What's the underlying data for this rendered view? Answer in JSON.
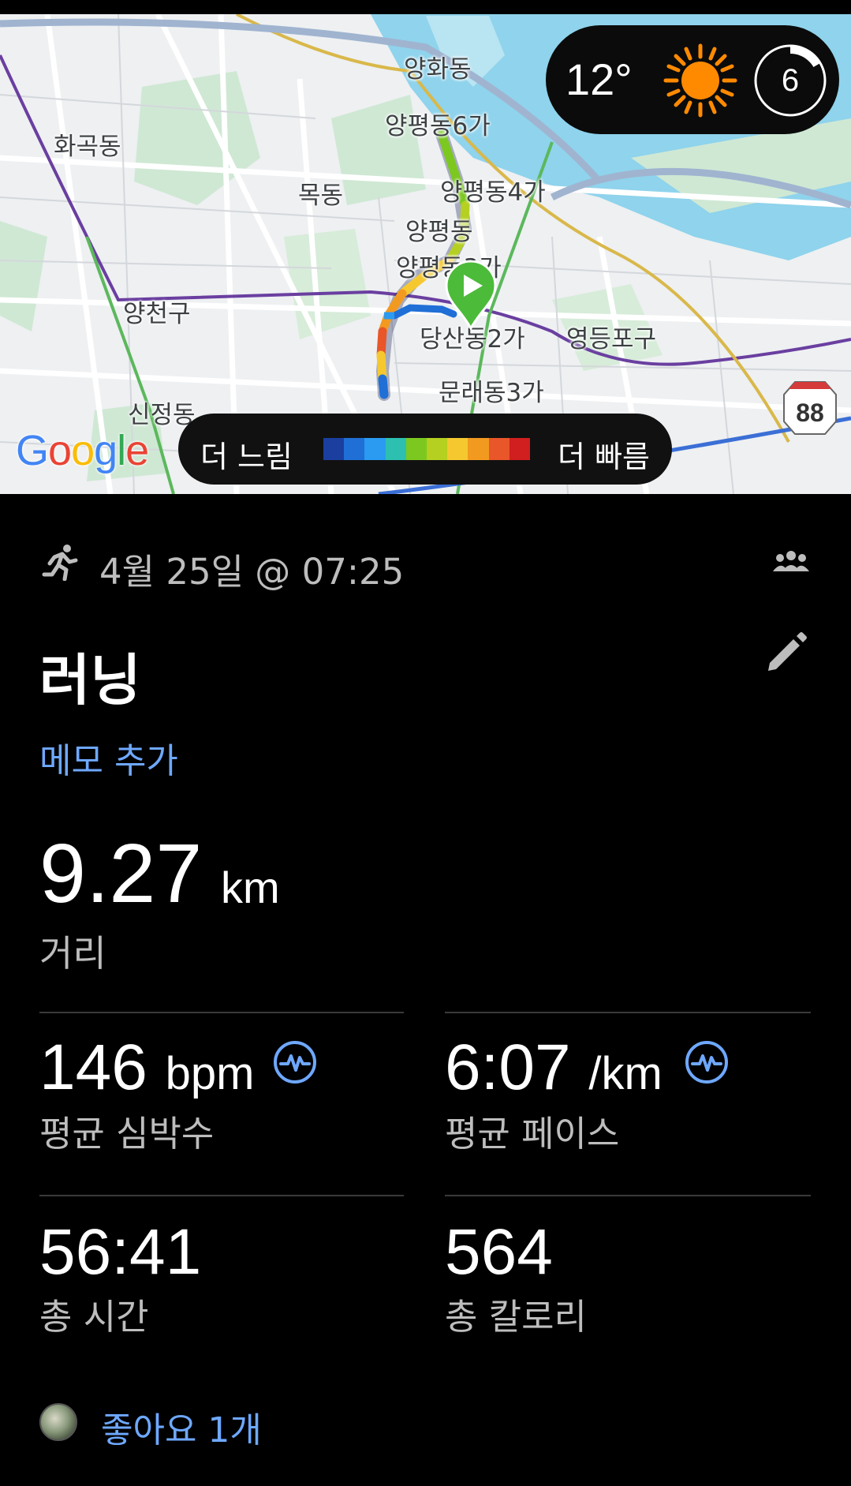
{
  "map": {
    "labels": [
      "양화동",
      "양평동6가",
      "화곡동",
      "목동",
      "양평동4가",
      "양평동",
      "양평동3가",
      "양천구",
      "당산동2가",
      "영등포구",
      "문래동3가",
      "신정동"
    ],
    "weather": {
      "temperature": "12°",
      "uv_index": "6",
      "icon": "sun-icon"
    },
    "google_logo": "Google",
    "route_marker": "88",
    "legend": {
      "slow_label": "더 느림",
      "fast_label": "더 빠름",
      "colors": [
        "#1a3f9e",
        "#1f6fd6",
        "#2a9bf0",
        "#2dc0b0",
        "#7cc820",
        "#b5d020",
        "#f5c830",
        "#f29a20",
        "#e8562a",
        "#d11e1e"
      ]
    }
  },
  "workout": {
    "activity_icon": "running-icon",
    "date": "4월 25일 @ 07:25",
    "title": "러닝",
    "add_memo": "메모 추가",
    "distance": {
      "value": "9.27",
      "unit": "km",
      "label": "거리"
    },
    "metrics": [
      {
        "value": "146",
        "unit": "bpm",
        "label": "평균 심박수",
        "icon": "pulse-icon"
      },
      {
        "value": "6:07",
        "unit": "/km",
        "label": "평균 페이스",
        "icon": "pulse-icon"
      },
      {
        "value": "56:41",
        "unit": "",
        "label": "총 시간"
      },
      {
        "value": "564",
        "unit": "",
        "label": "총 칼로리"
      }
    ],
    "likes": "좋아요 1개"
  },
  "colors": {
    "accent": "#6ea8ff",
    "background": "#000000",
    "secondary_text": "#bdbdbd"
  }
}
